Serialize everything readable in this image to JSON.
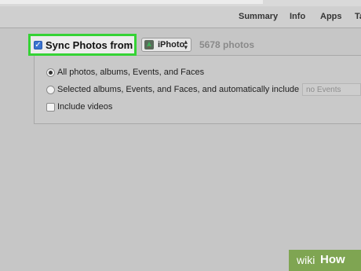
{
  "tabs": [
    "Summary",
    "Info",
    "Apps",
    "Ta"
  ],
  "sync": {
    "checked": true,
    "label": "Sync Photos from",
    "source": "iPhoto",
    "count": "5678 photos"
  },
  "options": {
    "all_label": "All photos, albums, Events, and Faces",
    "selected_label": "Selected albums, Events, and Faces, and automatically include",
    "events_value": "no Events",
    "videos_label": "Include videos",
    "selected_choice": "all"
  },
  "watermark": {
    "wiki": "wiki",
    "how": "How"
  },
  "colors": {
    "highlight": "#35d335",
    "checkbox": "#3b73d0",
    "watermark_bg": "#7fa552"
  }
}
